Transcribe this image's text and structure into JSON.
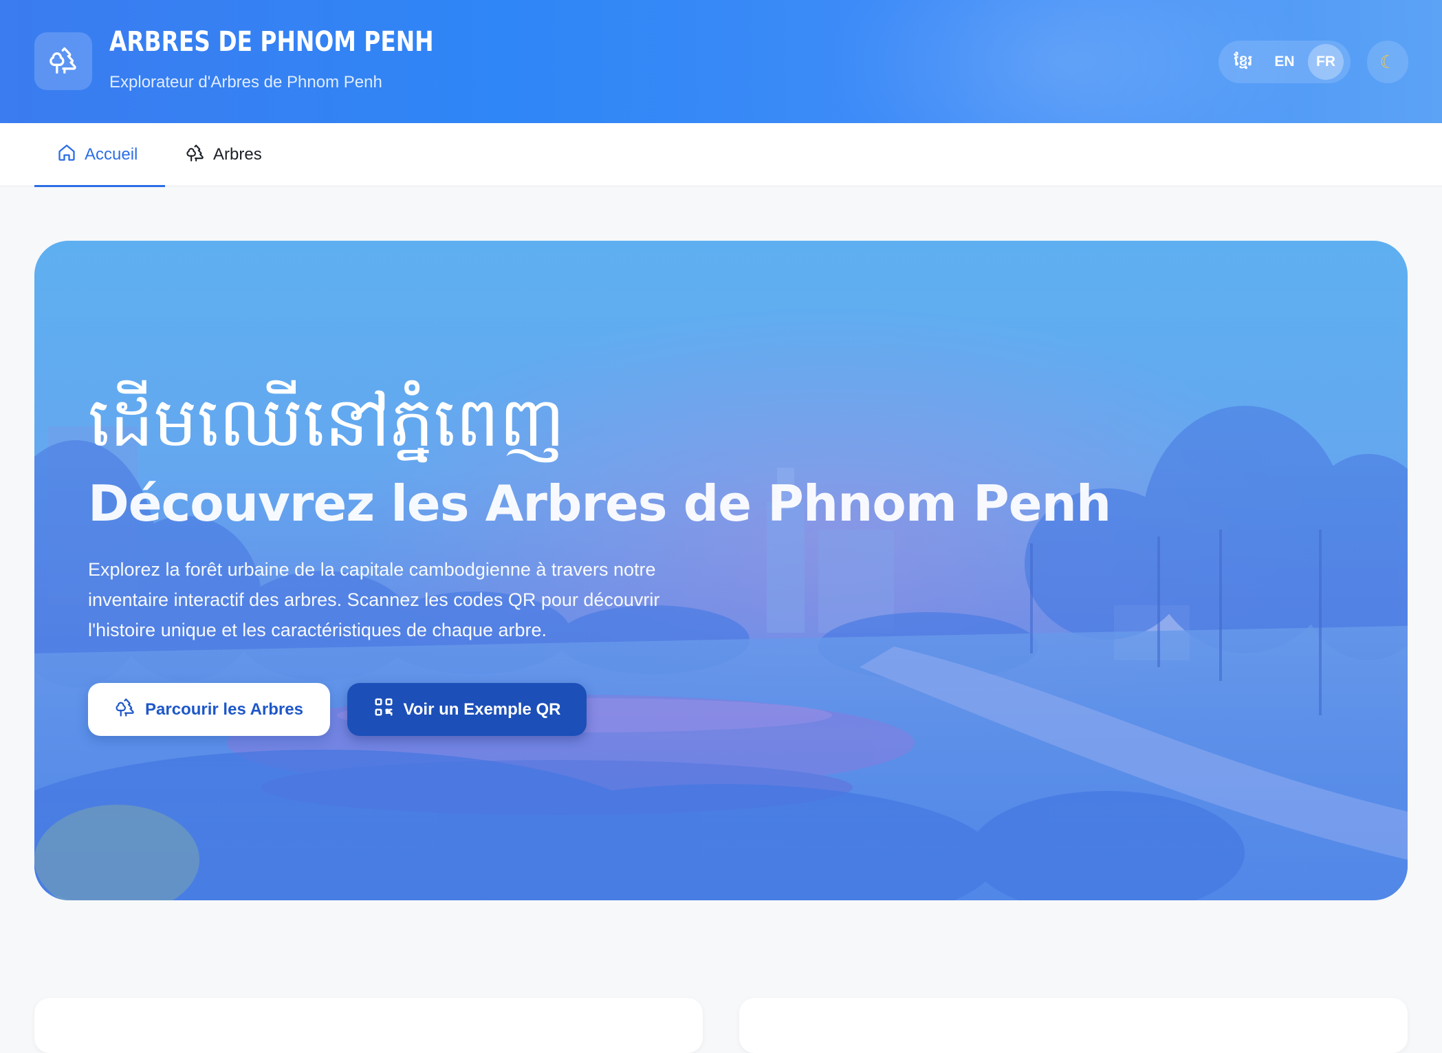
{
  "header": {
    "title": "ARBRES DE PHNOM PENH",
    "subtitle": "Explorateur d'Arbres de Phnom Penh",
    "logo_icon": "tree-icon",
    "languages": [
      "ខ្មែរ",
      "EN",
      "FR"
    ],
    "active_language": "FR",
    "theme_icon": "moon-icon"
  },
  "nav": {
    "tabs": [
      {
        "label": "Accueil",
        "icon": "home-icon",
        "active": true
      },
      {
        "label": "Arbres",
        "icon": "tree-icon",
        "active": false
      }
    ]
  },
  "hero": {
    "khmer_title": "ដើមឈើនៅភ្នំពេញ",
    "title": "Découvrez les Arbres de Phnom Penh",
    "description": "Explorez la forêt urbaine de la capitale cambodgienne à travers notre inventaire interactif des arbres. Scannez les codes QR pour découvrir l'histoire unique et les caractéristiques de chaque arbre.",
    "primary_button": "Parcourir les Arbres",
    "secondary_button": "Voir un Exemple QR"
  },
  "colors": {
    "accent": "#2c6ee6",
    "header_gradient_start": "#3b7cf0",
    "header_gradient_end": "#5ca3f6",
    "secondary_button": "#1c4fb8"
  }
}
